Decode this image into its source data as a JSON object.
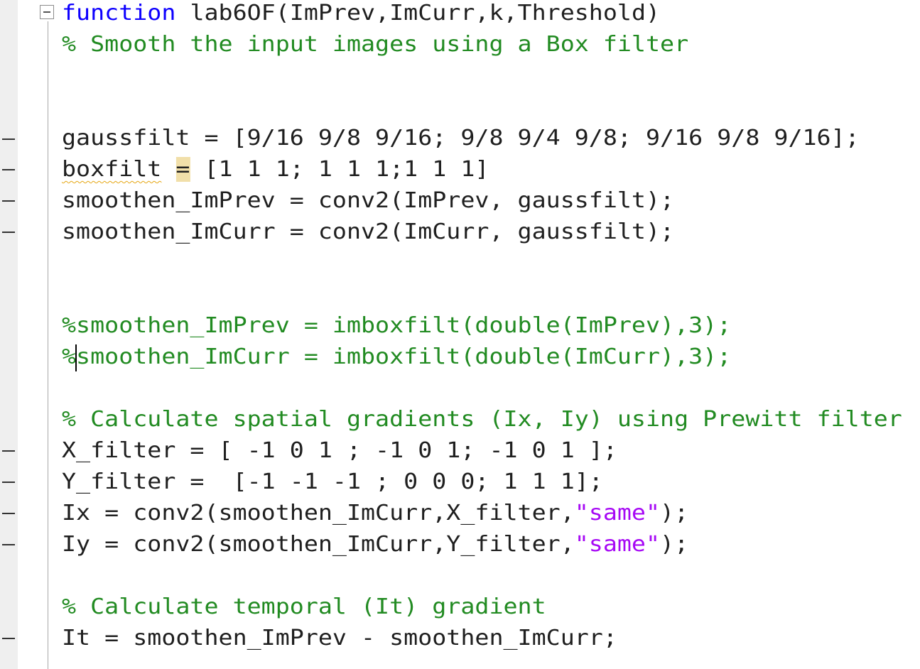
{
  "editor": {
    "lines": {
      "l1_keyword": "function",
      "l1_rest": " lab6OF(ImPrev,ImCurr,k,Threshold)",
      "l2": "% Smooth the input images using a Box filter",
      "l3": "gaussfilt = [9/16 9/8 9/16; 9/8 9/4 9/8; 9/16 9/8 9/16];",
      "l4_var": "boxfilt",
      "l4_sp": " ",
      "l4_eq": "=",
      "l4_rest": " [1 1 1; 1 1 1;1 1 1]",
      "l5": "smoothen_ImPrev = conv2(ImPrev, gaussfilt);",
      "l6": "smoothen_ImCurr = conv2(ImCurr, gaussfilt);",
      "l7": "%smoothen_ImPrev = imboxfilt(double(ImPrev),3);",
      "l8": "%smoothen_ImCurr = imboxfilt(double(ImCurr),3);",
      "l9": "% Calculate spatial gradients (Ix, Iy) using Prewitt filter",
      "l10": "X_filter = [ -1 0 1 ; -1 0 1; -1 0 1 ];",
      "l11": "Y_filter =  [-1 -1 -1 ; 0 0 0; 1 1 1];",
      "l12_pre": "Ix = conv2(smoothen_ImCurr,X_filter,",
      "l12_str": "\"same\"",
      "l12_post": ");",
      "l13_pre": "Iy = conv2(smoothen_ImCurr,Y_filter,",
      "l13_str": "\"same\"",
      "l13_post": ");",
      "l14": "% Calculate temporal (It) gradient",
      "l15": "It = smoothen_ImPrev - smoothen_ImCurr;"
    }
  },
  "colors": {
    "keyword": "#0e00ff",
    "comment": "#228b22",
    "string": "#a709f5",
    "code": "#1f1f1f",
    "warning_highlight": "#f1dfa9"
  }
}
